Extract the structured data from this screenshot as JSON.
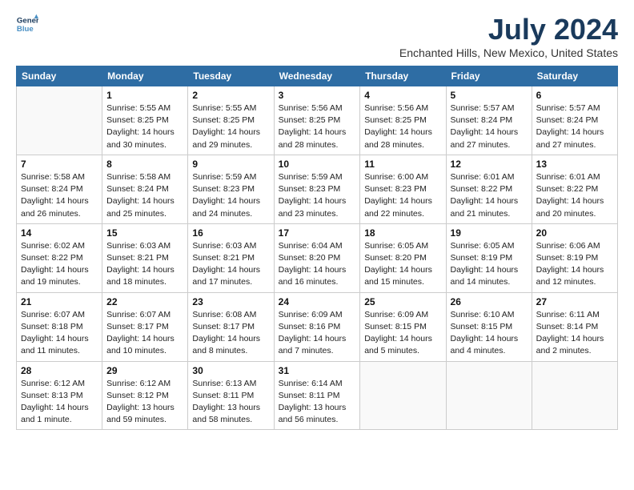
{
  "logo": {
    "line1": "General",
    "line2": "Blue"
  },
  "title": "July 2024",
  "subtitle": "Enchanted Hills, New Mexico, United States",
  "days_of_week": [
    "Sunday",
    "Monday",
    "Tuesday",
    "Wednesday",
    "Thursday",
    "Friday",
    "Saturday"
  ],
  "weeks": [
    [
      {
        "day": "",
        "info": ""
      },
      {
        "day": "1",
        "info": "Sunrise: 5:55 AM\nSunset: 8:25 PM\nDaylight: 14 hours\nand 30 minutes."
      },
      {
        "day": "2",
        "info": "Sunrise: 5:55 AM\nSunset: 8:25 PM\nDaylight: 14 hours\nand 29 minutes."
      },
      {
        "day": "3",
        "info": "Sunrise: 5:56 AM\nSunset: 8:25 PM\nDaylight: 14 hours\nand 28 minutes."
      },
      {
        "day": "4",
        "info": "Sunrise: 5:56 AM\nSunset: 8:25 PM\nDaylight: 14 hours\nand 28 minutes."
      },
      {
        "day": "5",
        "info": "Sunrise: 5:57 AM\nSunset: 8:24 PM\nDaylight: 14 hours\nand 27 minutes."
      },
      {
        "day": "6",
        "info": "Sunrise: 5:57 AM\nSunset: 8:24 PM\nDaylight: 14 hours\nand 27 minutes."
      }
    ],
    [
      {
        "day": "7",
        "info": "Sunrise: 5:58 AM\nSunset: 8:24 PM\nDaylight: 14 hours\nand 26 minutes."
      },
      {
        "day": "8",
        "info": "Sunrise: 5:58 AM\nSunset: 8:24 PM\nDaylight: 14 hours\nand 25 minutes."
      },
      {
        "day": "9",
        "info": "Sunrise: 5:59 AM\nSunset: 8:23 PM\nDaylight: 14 hours\nand 24 minutes."
      },
      {
        "day": "10",
        "info": "Sunrise: 5:59 AM\nSunset: 8:23 PM\nDaylight: 14 hours\nand 23 minutes."
      },
      {
        "day": "11",
        "info": "Sunrise: 6:00 AM\nSunset: 8:23 PM\nDaylight: 14 hours\nand 22 minutes."
      },
      {
        "day": "12",
        "info": "Sunrise: 6:01 AM\nSunset: 8:22 PM\nDaylight: 14 hours\nand 21 minutes."
      },
      {
        "day": "13",
        "info": "Sunrise: 6:01 AM\nSunset: 8:22 PM\nDaylight: 14 hours\nand 20 minutes."
      }
    ],
    [
      {
        "day": "14",
        "info": "Sunrise: 6:02 AM\nSunset: 8:22 PM\nDaylight: 14 hours\nand 19 minutes."
      },
      {
        "day": "15",
        "info": "Sunrise: 6:03 AM\nSunset: 8:21 PM\nDaylight: 14 hours\nand 18 minutes."
      },
      {
        "day": "16",
        "info": "Sunrise: 6:03 AM\nSunset: 8:21 PM\nDaylight: 14 hours\nand 17 minutes."
      },
      {
        "day": "17",
        "info": "Sunrise: 6:04 AM\nSunset: 8:20 PM\nDaylight: 14 hours\nand 16 minutes."
      },
      {
        "day": "18",
        "info": "Sunrise: 6:05 AM\nSunset: 8:20 PM\nDaylight: 14 hours\nand 15 minutes."
      },
      {
        "day": "19",
        "info": "Sunrise: 6:05 AM\nSunset: 8:19 PM\nDaylight: 14 hours\nand 14 minutes."
      },
      {
        "day": "20",
        "info": "Sunrise: 6:06 AM\nSunset: 8:19 PM\nDaylight: 14 hours\nand 12 minutes."
      }
    ],
    [
      {
        "day": "21",
        "info": "Sunrise: 6:07 AM\nSunset: 8:18 PM\nDaylight: 14 hours\nand 11 minutes."
      },
      {
        "day": "22",
        "info": "Sunrise: 6:07 AM\nSunset: 8:17 PM\nDaylight: 14 hours\nand 10 minutes."
      },
      {
        "day": "23",
        "info": "Sunrise: 6:08 AM\nSunset: 8:17 PM\nDaylight: 14 hours\nand 8 minutes."
      },
      {
        "day": "24",
        "info": "Sunrise: 6:09 AM\nSunset: 8:16 PM\nDaylight: 14 hours\nand 7 minutes."
      },
      {
        "day": "25",
        "info": "Sunrise: 6:09 AM\nSunset: 8:15 PM\nDaylight: 14 hours\nand 5 minutes."
      },
      {
        "day": "26",
        "info": "Sunrise: 6:10 AM\nSunset: 8:15 PM\nDaylight: 14 hours\nand 4 minutes."
      },
      {
        "day": "27",
        "info": "Sunrise: 6:11 AM\nSunset: 8:14 PM\nDaylight: 14 hours\nand 2 minutes."
      }
    ],
    [
      {
        "day": "28",
        "info": "Sunrise: 6:12 AM\nSunset: 8:13 PM\nDaylight: 14 hours\nand 1 minute."
      },
      {
        "day": "29",
        "info": "Sunrise: 6:12 AM\nSunset: 8:12 PM\nDaylight: 13 hours\nand 59 minutes."
      },
      {
        "day": "30",
        "info": "Sunrise: 6:13 AM\nSunset: 8:11 PM\nDaylight: 13 hours\nand 58 minutes."
      },
      {
        "day": "31",
        "info": "Sunrise: 6:14 AM\nSunset: 8:11 PM\nDaylight: 13 hours\nand 56 minutes."
      },
      {
        "day": "",
        "info": ""
      },
      {
        "day": "",
        "info": ""
      },
      {
        "day": "",
        "info": ""
      }
    ]
  ]
}
